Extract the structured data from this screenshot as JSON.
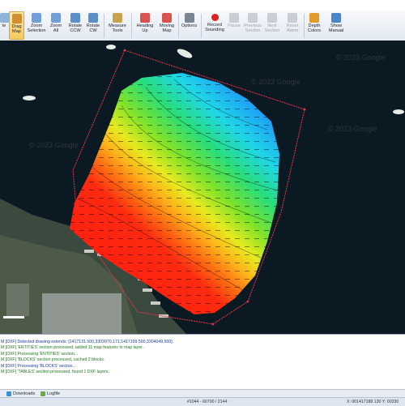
{
  "toolbar": {
    "buttons": [
      {
        "id": "te",
        "label": "te",
        "icon": "placeholder-icon"
      },
      {
        "id": "drag",
        "label": "Drag\nMap",
        "icon": "hand-icon",
        "active": true
      },
      {
        "id": "zoom-selection",
        "label": "Zoom\nSelection",
        "icon": "magnifier-icon"
      },
      {
        "id": "zoom-all",
        "label": "Zoom\nAll",
        "icon": "magnifier-icon"
      },
      {
        "id": "rotate-ccw",
        "label": "Rotate\nCCW",
        "icon": "rotate-ccw-icon"
      },
      {
        "id": "rotate-cw",
        "label": "Rotate\nCW",
        "icon": "rotate-cw-icon"
      },
      {
        "id": "measure",
        "label": "Measure\nTools",
        "icon": "ruler-icon"
      },
      {
        "id": "heading-up",
        "label": "Heading\nUp",
        "icon": "heading-icon"
      },
      {
        "id": "moving-map",
        "label": "Moving\nMap",
        "icon": "moving-map-icon"
      },
      {
        "id": "options",
        "label": "Options",
        "icon": "wrench-icon"
      },
      {
        "id": "record",
        "label": "Record\nSounding",
        "icon": "record-icon"
      },
      {
        "id": "pause",
        "label": "Pause",
        "icon": "pause-icon",
        "disabled": true
      },
      {
        "id": "previous-section",
        "label": "Previous\nSection",
        "icon": "previous-icon",
        "disabled": true
      },
      {
        "id": "next-section",
        "label": "Next\nSection",
        "icon": "next-icon",
        "disabled": true
      },
      {
        "id": "reset-alarm",
        "label": "Reset\nAlarm",
        "icon": "alarm-icon",
        "disabled": true
      },
      {
        "id": "depth-colors",
        "label": "Depth\nColors",
        "icon": "palette-icon"
      },
      {
        "id": "show-manual",
        "label": "Show\nManual",
        "icon": "book-icon"
      }
    ]
  },
  "map": {
    "watermarks": [
      "© 2023 Google",
      "© 2023 Google",
      "© 2023 Google",
      "© 2023 Google"
    ],
    "colors": {
      "deep": "#1e90ff",
      "red": "#ff1e10",
      "water": "#0b1a22",
      "boundary": "#e8344a"
    }
  },
  "log": {
    "lines": [
      {
        "text": "M [DXF] Detected drawing extends: [1417131.500,3303970.171,1417199.500,3304049.500].",
        "color": "b"
      },
      {
        "text": "M [DXF] 'ENTITIES' section processed, added 11 map features to map layer.",
        "color": "g"
      },
      {
        "text": "M [DXF] Processing 'ENTITIES' section...",
        "color": "g"
      },
      {
        "text": "M [DXF] 'BLOCKS' section processed, cached 2 blocks.",
        "color": "g"
      },
      {
        "text": "M [DXF] Processing 'BLOCKS' section...",
        "color": "b"
      },
      {
        "text": "M [DXF] 'TABLES' section processed, found 1 DXF layers.",
        "color": "g"
      }
    ]
  },
  "tabs": [
    {
      "label": "Downloads",
      "icon": "download-icon"
    },
    {
      "label": "Logfile",
      "icon": "logfile-icon"
    }
  ],
  "status": {
    "center": "#1044 - 60700 / 2144",
    "right": "X: 001417188.130  Y: 00330"
  }
}
